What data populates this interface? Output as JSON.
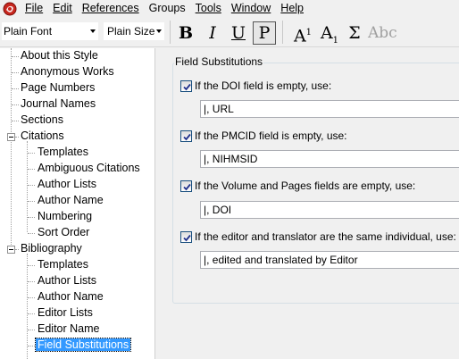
{
  "menubar": {
    "items": [
      {
        "label": "File"
      },
      {
        "label": "Edit"
      },
      {
        "label": "References"
      },
      {
        "label": "Groups"
      },
      {
        "label": "Tools"
      },
      {
        "label": "Window"
      },
      {
        "label": "Help"
      }
    ]
  },
  "toolbar": {
    "font": "Plain Font",
    "size": "Plain Size",
    "bold": "B",
    "italic": "I",
    "underline": "U",
    "plain": "P",
    "superscript_base": "A",
    "superscript_mark": "1",
    "subscript_base": "A",
    "subscript_mark": "1",
    "symbol": "Σ",
    "smallcaps": "Abc"
  },
  "tree": {
    "items": [
      {
        "label": "About this Style"
      },
      {
        "label": "Anonymous Works"
      },
      {
        "label": "Page Numbers"
      },
      {
        "label": "Journal Names"
      },
      {
        "label": "Sections"
      },
      {
        "label": "Citations"
      },
      {
        "label": "Templates"
      },
      {
        "label": "Ambiguous Citations"
      },
      {
        "label": "Author Lists"
      },
      {
        "label": "Author Name"
      },
      {
        "label": "Numbering"
      },
      {
        "label": "Sort Order"
      },
      {
        "label": "Bibliography"
      },
      {
        "label": "Templates"
      },
      {
        "label": "Author Lists"
      },
      {
        "label": "Author Name"
      },
      {
        "label": "Editor Lists"
      },
      {
        "label": "Editor Name"
      },
      {
        "label": "Field Substitutions"
      }
    ],
    "selected": "Field Substitutions"
  },
  "panel": {
    "title": "Field Substitutions",
    "options": [
      {
        "label": "If the DOI field is empty, use:",
        "checked": true,
        "value": "|, URL"
      },
      {
        "label": "If the PMCID field is empty, use:",
        "checked": true,
        "value": "|, NIHMSID"
      },
      {
        "label": "If the Volume and Pages fields are empty, use:",
        "checked": true,
        "value": "|, DOI"
      },
      {
        "label": "If the editor and translator are the same individual, use:",
        "checked": true,
        "value": "|, edited and translated by Editor"
      }
    ]
  },
  "colors": {
    "selection": "#3399ff",
    "checkbox_border": "#1c5180",
    "groupbox_border": "#d5dfe5"
  }
}
